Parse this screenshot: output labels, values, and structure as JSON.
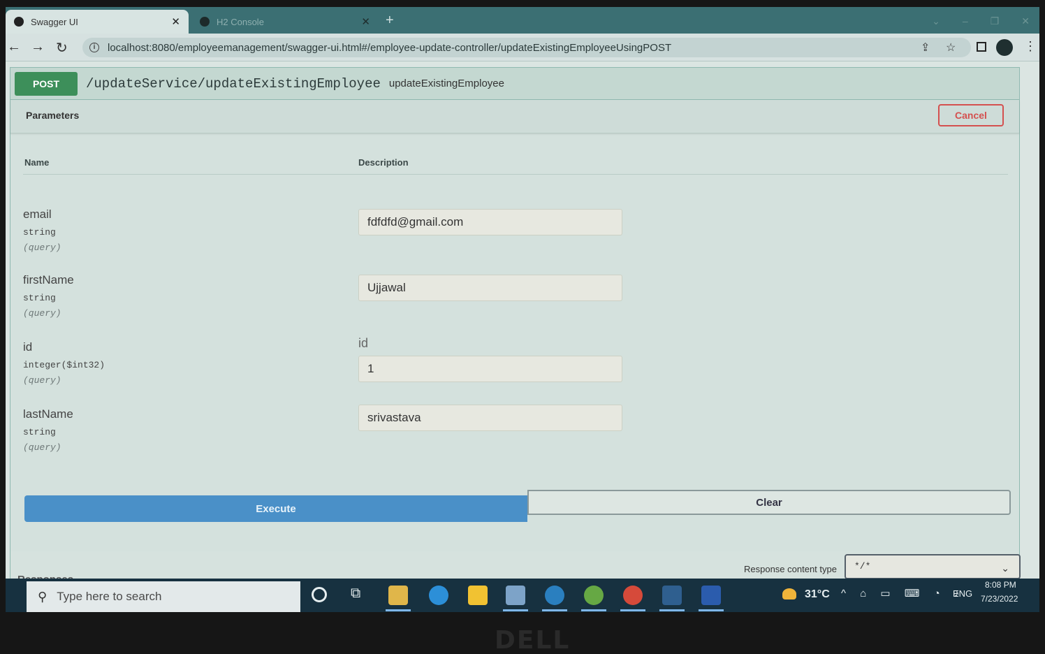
{
  "browser": {
    "tabs": [
      {
        "title": "Swagger UI",
        "active": true
      },
      {
        "title": "H2 Console",
        "active": false
      }
    ],
    "url": "localhost:8080/employeemanagement/swagger-ui.html#/employee-update-controller/updateExistingEmployeeUsingPOST"
  },
  "operation": {
    "method": "POST",
    "path": "/updateService/updateExistingEmployee",
    "summary": "updateExistingEmployee"
  },
  "parameters_section": {
    "title": "Parameters",
    "cancel_label": "Cancel",
    "col_name": "Name",
    "col_description": "Description",
    "params": [
      {
        "name": "email",
        "type": "string",
        "in": "(query)",
        "value": "fdfdfd@gmail.com",
        "label": ""
      },
      {
        "name": "firstName",
        "type": "string",
        "in": "(query)",
        "value": "Ujjawal",
        "label": ""
      },
      {
        "name": "id",
        "type": "integer($int32)",
        "in": "(query)",
        "value": "1",
        "label": "id"
      },
      {
        "name": "lastName",
        "type": "string",
        "in": "(query)",
        "value": "srivastava",
        "label": ""
      }
    ]
  },
  "actions": {
    "execute_label": "Execute",
    "clear_label": "Clear"
  },
  "responses": {
    "title": "Responses",
    "content_type_label": "Response content type",
    "content_type_value": "*/*"
  },
  "taskbar": {
    "search_placeholder": "Type here to search",
    "temperature": "31°C",
    "language": "ENG",
    "time": "8:08 PM",
    "date": "7/23/2022"
  },
  "monitor": {
    "brand": "DELL"
  },
  "colors": {
    "post_badge": "#3d8f5a",
    "execute": "#4a90c8",
    "cancel": "#d4504f"
  }
}
